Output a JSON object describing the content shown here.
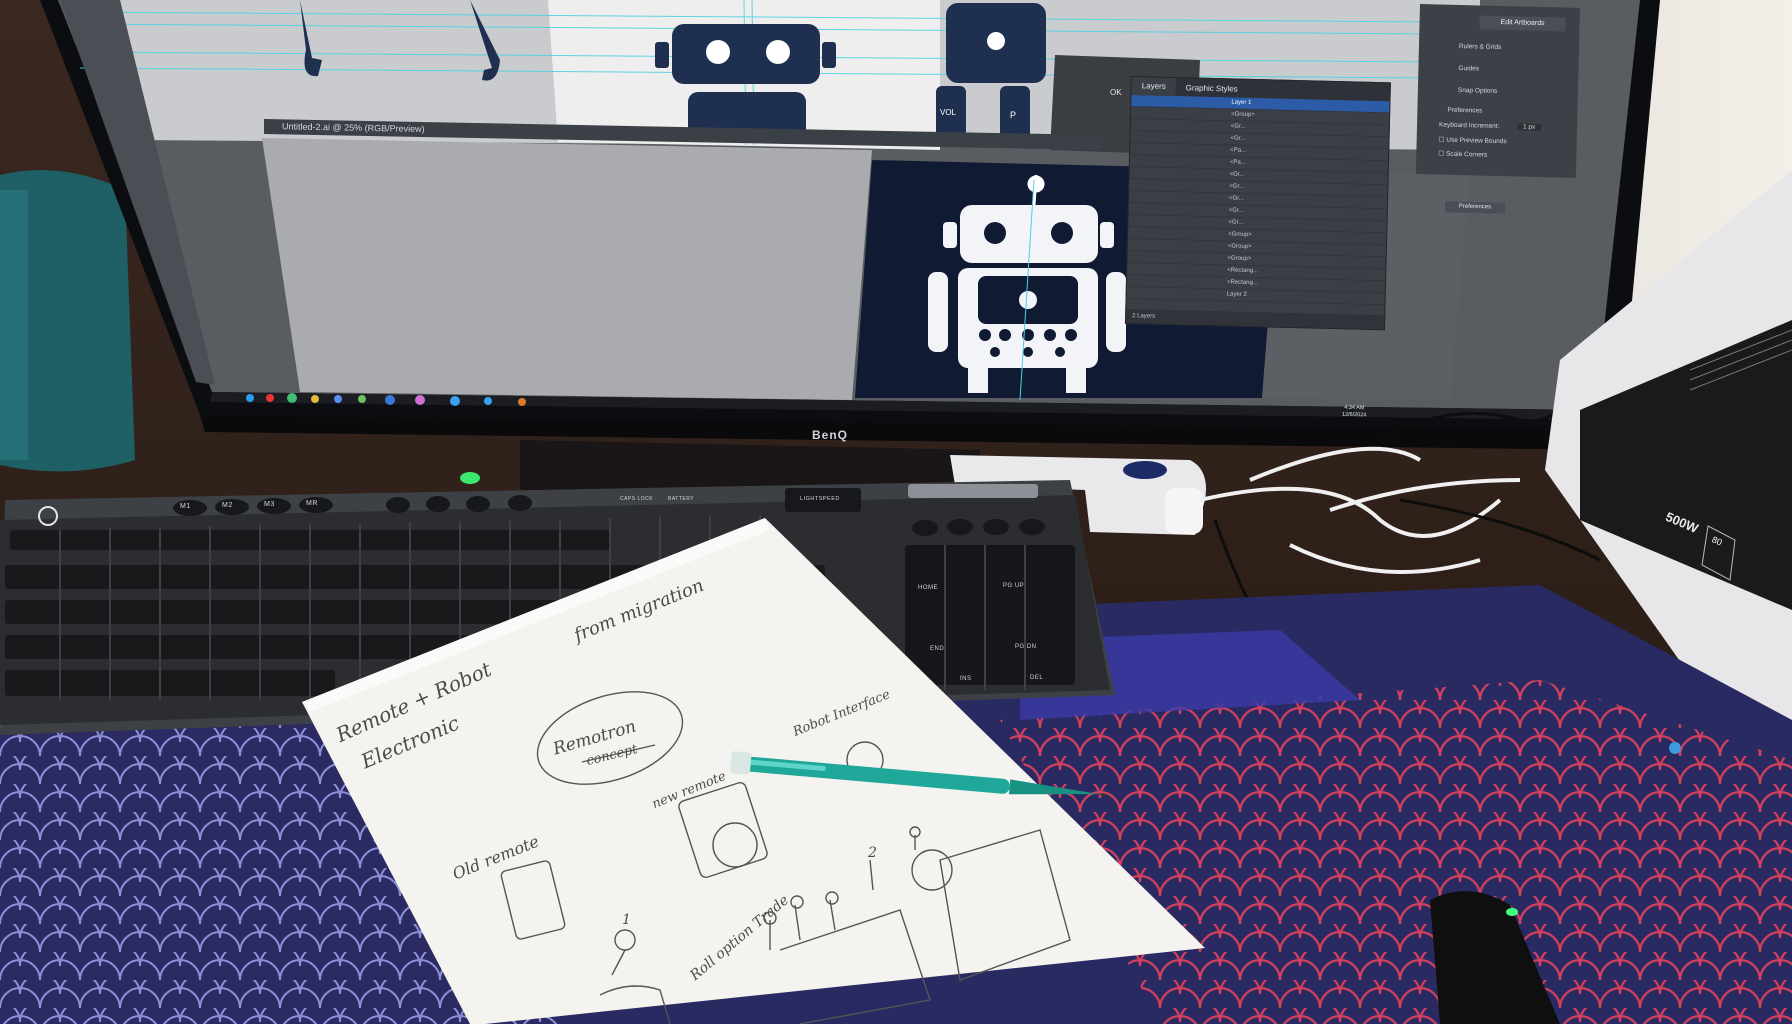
{
  "screen": {
    "document_tab": "Untitled-2.ai @ 25% (RGB/Preview)",
    "layers_panel": {
      "tabs": [
        "Layers",
        "Graphic Styles"
      ],
      "rows": [
        "Layer 1",
        "<Group>",
        "<Gr...",
        "<Gr...",
        "<Pa...",
        "<Pa...",
        "<Gr...",
        "<Gr...",
        "<Gr...",
        "<Gr...",
        "<Gr...",
        "<Group>",
        "<Group>",
        "<Group>",
        "<Rectang...",
        "<Rectang...",
        "Layer 2"
      ],
      "footer": "2 Layers"
    },
    "properties_panel": {
      "edit_artboards": "Edit Artboards",
      "rulers_grids": "Rulers & Grids",
      "guides": "Guides",
      "snap_options": "Snap Options",
      "preferences_heading": "Preferences",
      "keyboard_increment": "Keyboard Increment:",
      "keyboard_increment_value": "1 px",
      "use_preview_bounds": "Use Preview Bounds",
      "scale_corners": "Scale Corners",
      "preferences_button": "Preferences"
    },
    "remote_labels": {
      "vol": "VOL",
      "p": "P",
      "ok": "OK"
    },
    "taskbar": {
      "time": "4:34 AM",
      "date": "12/6/2024"
    }
  },
  "monitor_brand": "BenQ",
  "keyboard": {
    "macro_keys": [
      "M1",
      "M2",
      "M3",
      "MR"
    ],
    "labels": [
      "CAPS LOCK",
      "BATTERY",
      "LIGHTSPEED"
    ],
    "nav_keys": [
      "HOME",
      "PG UP",
      "END",
      "PG DN",
      "INS",
      "DEL"
    ]
  },
  "psu": {
    "wattage": "500W",
    "badge": "80"
  },
  "sketch_notes": {
    "remote_robot": "Remote + Robot",
    "electronic": "Electronic",
    "from_migration": "from migration",
    "remotron": "Remotron",
    "concept": "concept",
    "robot_interface": "Robot Interface",
    "new_remote": "new remote",
    "old_remote": "Old remote",
    "roll_option_trade": "Roll option Trade",
    "marker_1": "1",
    "marker_2": "2"
  },
  "colors": {
    "desk_mat": "#2b2a63",
    "mat_scales_left": "#8b8fd6",
    "mat_scales_right": "#d1405c",
    "pen": "#1fa89a",
    "screen_dark": "#101a33",
    "illustrator_gray": "#535559"
  }
}
